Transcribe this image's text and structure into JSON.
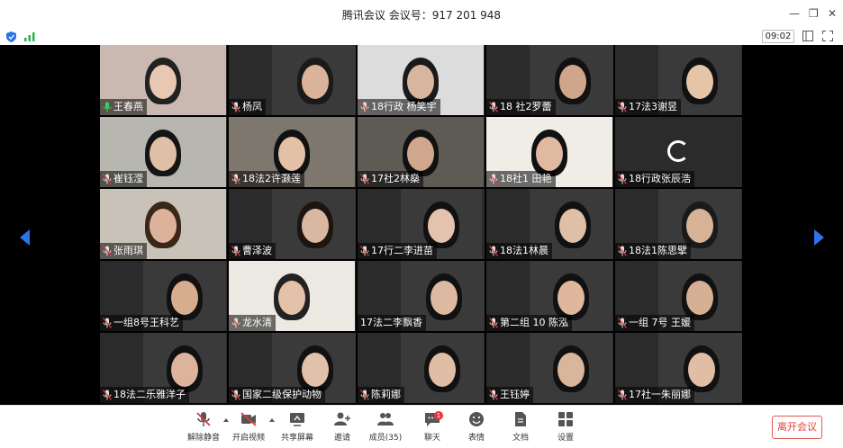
{
  "window": {
    "title": "腾讯会议  会议号：917 201 948"
  },
  "status": {
    "timer": "09:02"
  },
  "participants": [
    {
      "name": "王春燕",
      "speaking": true
    },
    {
      "name": "杨凤"
    },
    {
      "name": "18行政 杨笑宇"
    },
    {
      "name": "18 社2罗蕾"
    },
    {
      "name": "17法3谢昱"
    },
    {
      "name": "崔钰滢"
    },
    {
      "name": "18法2许灏莲"
    },
    {
      "name": "17社2林燊"
    },
    {
      "name": "18社1 田艳"
    },
    {
      "name": "18行政张辰浩",
      "video_off": true
    },
    {
      "name": "张雨琪"
    },
    {
      "name": "曹泽波"
    },
    {
      "name": "17行二李进苗"
    },
    {
      "name": "18法1林晨"
    },
    {
      "name": "18法1陈思擘"
    },
    {
      "name": "一组8号王科艺"
    },
    {
      "name": "龙水清"
    },
    {
      "name": "17法二李飘香",
      "no_mic_icon": true
    },
    {
      "name": "第二组 10 陈泓"
    },
    {
      "name": "一组 7号 王媛"
    },
    {
      "name": "18法二乐雅洋子"
    },
    {
      "name": "国家二级保护动物"
    },
    {
      "name": "陈莉娜"
    },
    {
      "name": "王钰婷"
    },
    {
      "name": "17社一朱丽娜"
    }
  ],
  "toolbar": {
    "unmute": "解除静音",
    "start_video": "开启视频",
    "share_screen": "共享屏幕",
    "invite": "邀请",
    "members": "成员(35)",
    "chat": "聊天",
    "chat_badge": "1",
    "emoji": "表情",
    "docs": "文档",
    "settings": "设置",
    "leave": "离开会议"
  }
}
